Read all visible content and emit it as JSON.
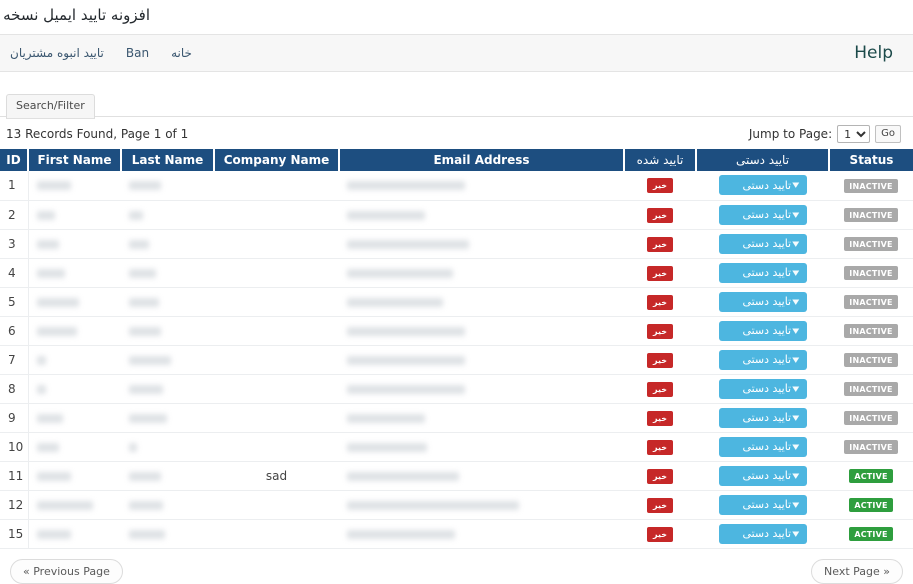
{
  "page": {
    "title": "افزونه تایید ایمیل نسخه پرو"
  },
  "nav": {
    "items": [
      {
        "label": "خانه",
        "latin": false
      },
      {
        "label": "Ban",
        "latin": true
      },
      {
        "label": "تایید انبوه مشتریان",
        "latin": false
      }
    ],
    "help_label": "Help"
  },
  "tabs": {
    "search_filter_label": "Search/Filter"
  },
  "records": {
    "summary": "13 Records Found, Page 1 of 1",
    "jump_label": "Jump to Page:",
    "jump_selected": "1",
    "jump_options": [
      "1"
    ],
    "go_label": "Go"
  },
  "table": {
    "columns": [
      {
        "key": "id",
        "label": "ID",
        "rtl": false
      },
      {
        "key": "first_name",
        "label": "First Name",
        "rtl": false
      },
      {
        "key": "last_name",
        "label": "Last Name",
        "rtl": false
      },
      {
        "key": "company",
        "label": "Company Name",
        "rtl": false
      },
      {
        "key": "email",
        "label": "Email Address",
        "rtl": false
      },
      {
        "key": "verified",
        "label": "تایید شده",
        "rtl": true
      },
      {
        "key": "manual",
        "label": "تایید دستی",
        "rtl": true
      },
      {
        "key": "status",
        "label": "Status",
        "rtl": false
      }
    ],
    "verified_badge_label": "خیر",
    "manual_select_label": "تایید دستی",
    "status_labels": {
      "inactive": "INACTIVE",
      "active": "ACTIVE"
    },
    "rows": [
      {
        "id": "1",
        "first_name": "",
        "last_name": "",
        "company": "",
        "email": "",
        "verified": "خیر",
        "manual": "تایید دستی",
        "status": "INACTIVE",
        "redact": {
          "first": 34,
          "last": 32,
          "email": 118
        }
      },
      {
        "id": "2",
        "first_name": "",
        "last_name": "",
        "company": "",
        "email": "",
        "verified": "خیر",
        "manual": "تایید دستی",
        "status": "INACTIVE",
        "redact": {
          "first": 18,
          "last": 14,
          "email": 78
        }
      },
      {
        "id": "3",
        "first_name": "",
        "last_name": "",
        "company": "",
        "email": "",
        "verified": "خیر",
        "manual": "تایید دستی",
        "status": "INACTIVE",
        "redact": {
          "first": 22,
          "last": 20,
          "email": 122
        }
      },
      {
        "id": "4",
        "first_name": "",
        "last_name": "",
        "company": "",
        "email": "",
        "verified": "خیر",
        "manual": "تایید دستی",
        "status": "INACTIVE",
        "redact": {
          "first": 28,
          "last": 27,
          "email": 106
        }
      },
      {
        "id": "5",
        "first_name": "",
        "last_name": "",
        "company": "",
        "email": "",
        "verified": "خیر",
        "manual": "تایید دستی",
        "status": "INACTIVE",
        "redact": {
          "first": 42,
          "last": 30,
          "email": 96
        }
      },
      {
        "id": "6",
        "first_name": "",
        "last_name": "",
        "company": "",
        "email": "",
        "verified": "خیر",
        "manual": "تایید دستی",
        "status": "INACTIVE",
        "redact": {
          "first": 40,
          "last": 32,
          "email": 118
        }
      },
      {
        "id": "7",
        "first_name": "",
        "last_name": "",
        "company": "",
        "email": "",
        "verified": "خیر",
        "manual": "تایید دستی",
        "status": "INACTIVE",
        "redact": {
          "first": 9,
          "last": 42,
          "email": 118
        }
      },
      {
        "id": "8",
        "first_name": "",
        "last_name": "",
        "company": "",
        "email": "",
        "verified": "خیر",
        "manual": "تایید دستی",
        "status": "INACTIVE",
        "redact": {
          "first": 9,
          "last": 34,
          "email": 118
        }
      },
      {
        "id": "9",
        "first_name": "",
        "last_name": "",
        "company": "",
        "email": "",
        "verified": "خیر",
        "manual": "تایید دستی",
        "status": "INACTIVE",
        "redact": {
          "first": 26,
          "last": 38,
          "email": 78
        }
      },
      {
        "id": "10",
        "first_name": "",
        "last_name": "",
        "company": "",
        "email": "",
        "verified": "خیر",
        "manual": "تایید دستی",
        "status": "INACTIVE",
        "redact": {
          "first": 22,
          "last": 8,
          "email": 80
        }
      },
      {
        "id": "11",
        "first_name": "",
        "last_name": "",
        "company": "sad",
        "email": "",
        "verified": "خیر",
        "manual": "تایید دستی",
        "status": "ACTIVE",
        "redact": {
          "first": 34,
          "last": 32,
          "email": 112
        }
      },
      {
        "id": "12",
        "first_name": "",
        "last_name": "",
        "company": "",
        "email": "",
        "verified": "خیر",
        "manual": "تایید دستی",
        "status": "ACTIVE",
        "redact": {
          "first": 56,
          "last": 34,
          "email": 172
        }
      },
      {
        "id": "15",
        "first_name": "",
        "last_name": "",
        "company": "",
        "email": "",
        "verified": "خیر",
        "manual": "تایید دستی",
        "status": "ACTIVE",
        "redact": {
          "first": 34,
          "last": 36,
          "email": 108
        }
      }
    ]
  },
  "pager": {
    "previous_label": "« Previous Page",
    "next_label": "Next Page »"
  },
  "colors": {
    "header_blue": "#1d4e80",
    "select_blue": "#4db6e0",
    "badge_red": "#c62828",
    "badge_green": "#2e9e3e",
    "badge_gray": "#a9a9a9",
    "help_teal": "#1c4a4a"
  }
}
